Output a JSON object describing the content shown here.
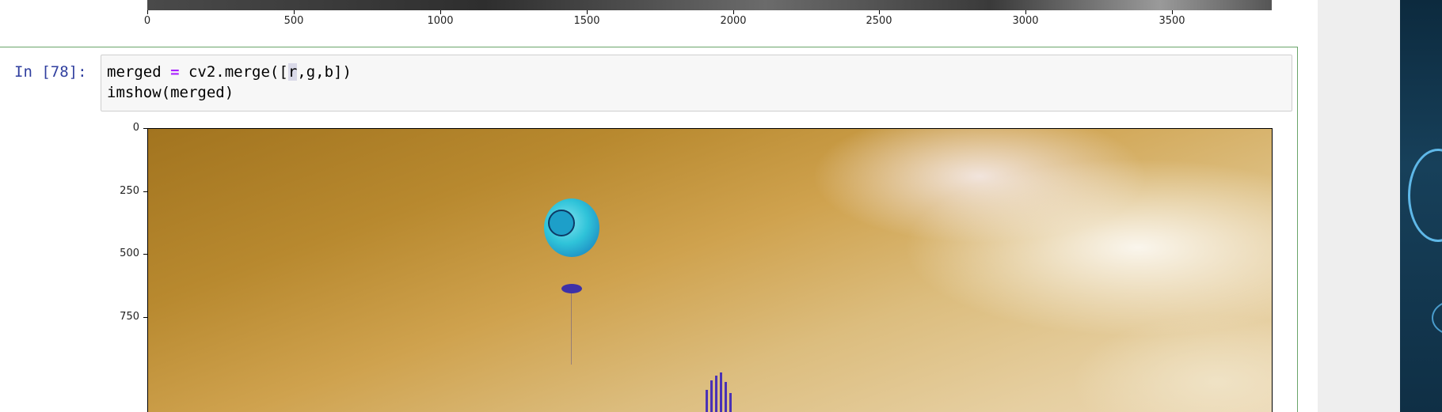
{
  "previous_output": {
    "x_ticks": [
      "0",
      "500",
      "1000",
      "1500",
      "2000",
      "2500",
      "3000",
      "3500"
    ]
  },
  "cell": {
    "prompt": "In [78]:",
    "code_lines": [
      {
        "before": "merged ",
        "op": "=",
        "mid": " cv2.merge([",
        "highlight": "r",
        "after": ",g,b])"
      },
      {
        "before": "imshow(merged)",
        "op": "",
        "mid": "",
        "highlight": "",
        "after": ""
      }
    ]
  },
  "output_image": {
    "y_ticks": [
      "0",
      "250",
      "500",
      "750"
    ],
    "description_colors": {
      "sky_top": "#a2741f",
      "sky_bottom": "#ecd8b5",
      "balloon": "#2fc3d9",
      "tower": "#4a32b5"
    }
  }
}
